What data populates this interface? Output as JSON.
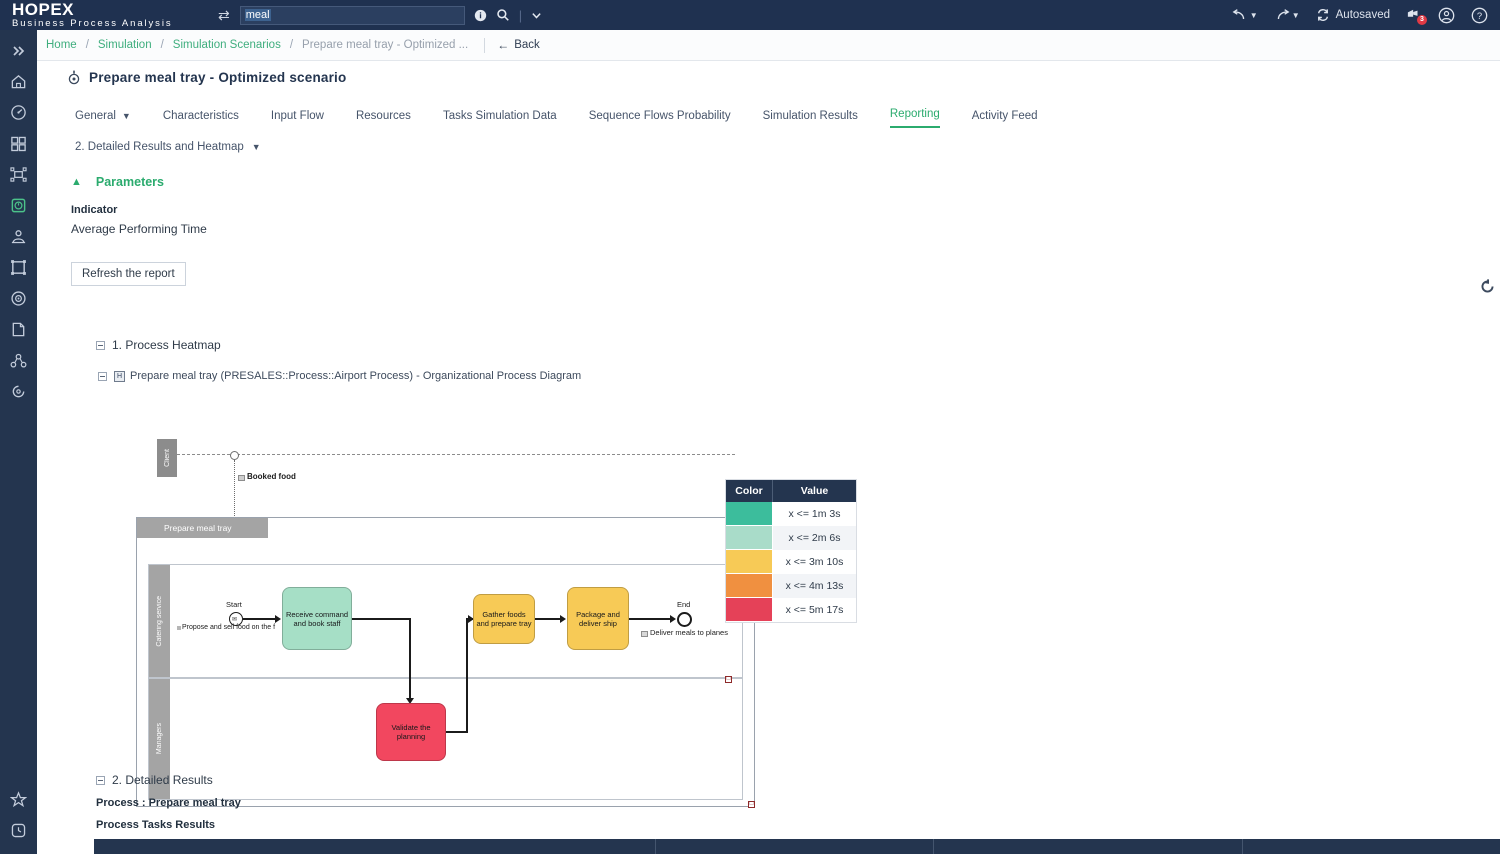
{
  "topbar": {
    "brand_line1": "HOPEX",
    "brand_line2": "Business Process Analysis",
    "swap_icon": "swap-icon",
    "search_value": "meal",
    "search_placeholder": "",
    "info_icon": "info-icon",
    "search_icon": "search-icon",
    "search_dropdown_icon": "chevron-down-icon",
    "undo_label": "undo-icon",
    "redo_label": "redo-icon",
    "sync_icon": "sync-icon",
    "autosaved": "Autosaved",
    "bell_icon": "notification-bell-icon",
    "bell_badge": "3",
    "account_icon": "user-account-icon",
    "help_icon": "help-icon"
  },
  "breadcrumb": {
    "menu_icon": "hamburger-menu-icon",
    "items": [
      {
        "label": "Home",
        "current": false
      },
      {
        "label": "Simulation",
        "current": false
      },
      {
        "label": "Simulation Scenarios",
        "current": false
      },
      {
        "label": "Prepare meal tray - Optimized ...",
        "current": true
      }
    ],
    "separator": "/",
    "back_label": "Back",
    "back_icon": "arrow-left-icon"
  },
  "rail": {
    "top_icons": [
      "expand-chevrons-icon",
      "home-icon",
      "dashboard-gauge-icon",
      "grid-blocks-icon",
      "process-flow-icon",
      "clock-shield-icon",
      "person-role-icon",
      "frame-icon",
      "target-gear-icon",
      "document-edit-icon",
      "network-diagram-icon",
      "lifecycle-icon"
    ],
    "bottom_icons": [
      "star-favorites-icon",
      "recent-history-icon"
    ],
    "active_index": 5
  },
  "page": {
    "title_icon": "gear-circle-icon",
    "title": "Prepare meal tray - Optimized scenario",
    "reload_icon": "reload-icon"
  },
  "tabs": [
    {
      "label": "General",
      "active": false,
      "has_caret": true
    },
    {
      "label": "Characteristics",
      "active": false,
      "has_caret": false
    },
    {
      "label": "Input Flow",
      "active": false,
      "has_caret": false
    },
    {
      "label": "Resources",
      "active": false,
      "has_caret": false
    },
    {
      "label": "Tasks Simulation Data",
      "active": false,
      "has_caret": false
    },
    {
      "label": "Sequence Flows Probability",
      "active": false,
      "has_caret": false
    },
    {
      "label": "Simulation Results",
      "active": false,
      "has_caret": false
    },
    {
      "label": "Reporting",
      "active": true,
      "has_caret": false
    },
    {
      "label": "Activity Feed",
      "active": false,
      "has_caret": false
    }
  ],
  "subtab": {
    "label": "2. Detailed Results and Heatmap",
    "caret": "chevron-down-icon"
  },
  "parameters": {
    "collapse_icon": "chevron-up-icon",
    "title": "Parameters",
    "indicator_label": "Indicator",
    "indicator_value": "Average Performing Time",
    "refresh_label": "Refresh the report"
  },
  "report": {
    "section1_title": "1. Process Heatmap",
    "diagram_caption": "Prepare meal tray (PRESALES::Process::Airport Process) - Organizational Process Diagram",
    "diagram_icon": "diagram-node-icon",
    "section2_title": "2. Detailed Results",
    "process_line": "Process : Prepare meal tray",
    "tasks_results_line": "Process Tasks Results"
  },
  "diagram": {
    "client_lane": "Client",
    "pool_label": "Prepare meal tray",
    "lanes": [
      "Catering service",
      "Managers"
    ],
    "message_flow_label": "Booked food",
    "start_label": "Start",
    "start_annotation": "Propose and sell food on the f",
    "end_label": "End",
    "end_annotation": "Deliver meals to planes",
    "tasks": [
      {
        "label": "Receive command and book staff",
        "color": "#a6dfc6"
      },
      {
        "label": "Gather foods and prepare tray",
        "color": "#f7ca56"
      },
      {
        "label": "Package and deliver ship",
        "color": "#f7ca56"
      },
      {
        "label": "Validate the planning",
        "color": "#f2475f"
      }
    ]
  },
  "legend": {
    "headers": [
      "Color",
      "Value"
    ],
    "rows": [
      {
        "color": "#3cbd9c",
        "value": "x <= 1m 3s"
      },
      {
        "color": "#a9dcc9",
        "value": "x <= 2m 6s"
      },
      {
        "color": "#f7ca56",
        "value": "x <= 3m 10s"
      },
      {
        "color": "#f09040",
        "value": "x <= 4m 13s"
      },
      {
        "color": "#e54158",
        "value": "x <= 5m 17s"
      }
    ]
  },
  "chart_data": {
    "type": "heatmap",
    "title": "Process Heatmap - Average Performing Time",
    "categories": [
      "Receive command and book staff",
      "Gather foods and prepare tray",
      "Package and deliver ship",
      "Validate the planning"
    ],
    "bands": [
      "x <= 1m 3s",
      "x <= 2m 6s",
      "x <= 3m 10s",
      "x <= 4m 13s",
      "x <= 5m 17s"
    ],
    "band_colors": [
      "#3cbd9c",
      "#a9dcc9",
      "#f7ca56",
      "#f09040",
      "#e54158"
    ],
    "values": [
      "x <= 2m 6s",
      "x <= 3m 10s",
      "x <= 3m 10s",
      "x <= 5m 17s"
    ],
    "value_colors": [
      "#a6dfc6",
      "#f7ca56",
      "#f7ca56",
      "#f2475f"
    ],
    "xlabel": "",
    "ylabel": "",
    "legend_position": "right"
  }
}
